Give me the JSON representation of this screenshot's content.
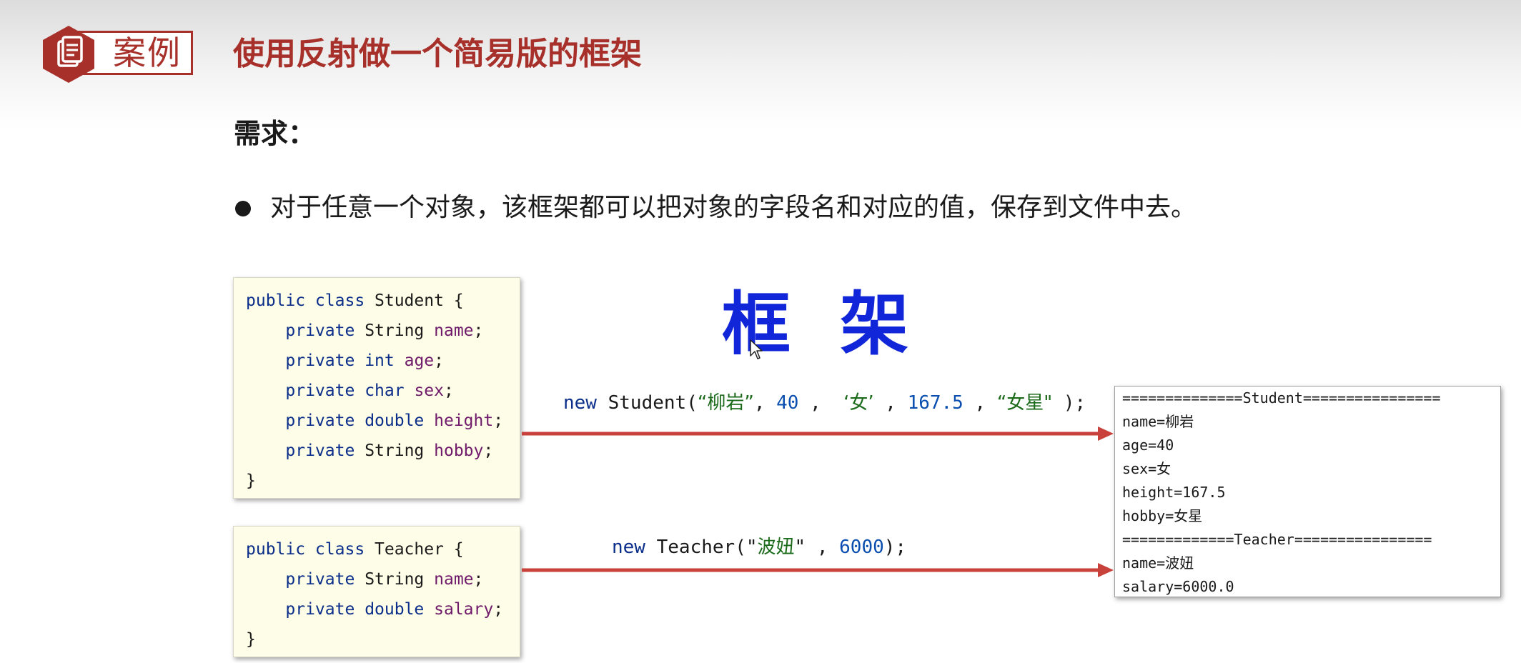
{
  "header": {
    "badge_label": "案例",
    "title": "使用反射做一个简易版的框架"
  },
  "requirements": {
    "heading": "需求：",
    "bullets": [
      "对于任意一个对象，该框架都可以把对象的字段名和对应的值，保存到文件中去。"
    ]
  },
  "student_class": {
    "header_kw": "public class",
    "header_name": " Student {",
    "fields": [
      {
        "modifier": "private",
        "type": "String",
        "name": "name"
      },
      {
        "modifier": "private",
        "type": "int",
        "name": "age"
      },
      {
        "modifier": "private",
        "type": "char",
        "name": "sex"
      },
      {
        "modifier": "private",
        "type": "double",
        "name": "height"
      },
      {
        "modifier": "private",
        "type": "String",
        "name": "hobby"
      }
    ],
    "closing": "}"
  },
  "teacher_class": {
    "header_kw": "public class",
    "header_name": " Teacher {",
    "fields": [
      {
        "modifier": "private",
        "type": "String",
        "name": "name"
      },
      {
        "modifier": "private",
        "type": "double",
        "name": "salary"
      }
    ],
    "closing": "}"
  },
  "framework_label": "框 架",
  "calls": {
    "student": {
      "kw": "new",
      "name": " Student(",
      "arg1": "“柳岩”",
      "sep1": ", ",
      "arg2": "40",
      "sep2": " ,  ",
      "arg3": "‘女’",
      "sep3": " , ",
      "arg4": "167.5",
      "sep4": " , ",
      "arg5": "“女星\"",
      "end": " );"
    },
    "teacher": {
      "kw": "new",
      "name": " Teacher(\"",
      "arg1": "波妞",
      "sep1": "\" , ",
      "arg2": "6000",
      "end": ");"
    }
  },
  "output_lines": [
    "==============Student================",
    "name=柳岩",
    "age=40",
    "sex=女",
    "height=167.5",
    "hobby=女星",
    "=============Teacher================",
    "name=波妞",
    "salary=6000.0"
  ],
  "colors": {
    "accent": "#a8302a",
    "framework_blue": "#1126d8",
    "arrow": "#c8413a",
    "code_bg": "#fefde7"
  }
}
